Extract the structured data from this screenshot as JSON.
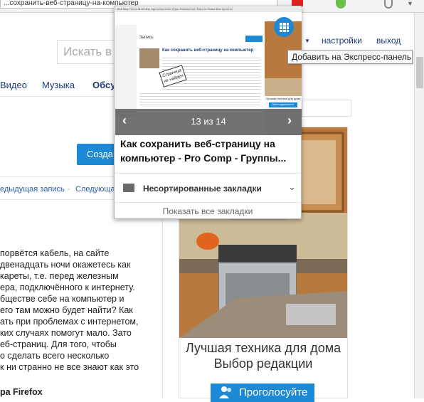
{
  "browser": {
    "url_text": "...сохранить-веб-страницу-на-компьютер"
  },
  "header": {
    "search_placeholder": "Искать в н",
    "settings_label": "настройки",
    "exit_label": "выход"
  },
  "nav": {
    "video": "Видео",
    "music": "Музыка",
    "discussions": "Обсу"
  },
  "tooltip": "Добавить на Экспресс-панель",
  "left": {
    "create_button": "Созда",
    "prev_post": "едыдущая запись",
    "sep": "·",
    "next_post": "Следующа",
    "lines": [
      "порвётся кабель, на сайте",
      "двенадцать ночи окажетесь как",
      "кареты, т.е. перед железным",
      "ера, подключённого к интернету.",
      "бществе себе на компьютер и",
      "его там можно будет найти? Как",
      "ать при проблемах с интернетом,",
      "ких случаях помогут мало. Зато",
      "еб-страниц. Для того, чтобы",
      "о сделать всего несколько",
      "к ни странно не все знают как это"
    ],
    "footer_word": "ра Firefox"
  },
  "popup": {
    "counter": "13 из 14",
    "bookmark_title": "Как сохранить веб-страницу на компьютер - Pro Comp - Группы...",
    "folder_name": "Несортированные закладки",
    "show_all": "Показать все закладки",
    "thumb": {
      "site_nav": "Моё Мир  Почта  Мой Мир  Одноклассники  Игры  Знакомства  Новости  Поиск  Все проекты",
      "post_header": "Запись",
      "post_title": "Как сохранить веб-страницу на компьютер",
      "sticker_line1": "Страница",
      "sticker_line2": "не найден",
      "side_caption": "Лучшая техника для дома",
      "side_button": "Присоединиться"
    }
  },
  "ad": {
    "line1": "Лучшая техника для дома",
    "line2": "Выбор редакции",
    "button": "Проголосуйте"
  },
  "colors": {
    "accent": "#1e8ad6",
    "link": "#1a3a7a"
  }
}
